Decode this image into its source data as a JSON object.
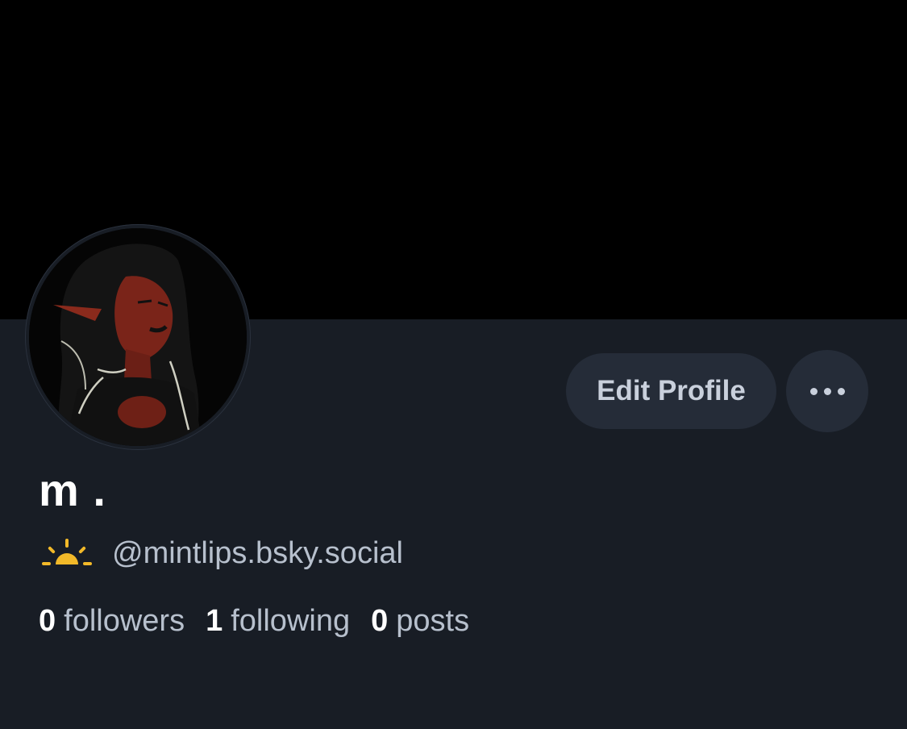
{
  "profile": {
    "display_name": "m .",
    "handle": "@mintlips.bsky.social",
    "handle_icon": "sunrise-icon",
    "banner_color": "#000000",
    "avatar_description_icon": "avatar-image"
  },
  "actions": {
    "edit_label": "Edit Profile",
    "more_icon": "ellipsis-icon"
  },
  "stats": {
    "followers": {
      "count": "0",
      "label": "followers"
    },
    "following": {
      "count": "1",
      "label": "following"
    },
    "posts": {
      "count": "0",
      "label": "posts"
    }
  },
  "colors": {
    "background": "#181d25",
    "button_bg": "#252c38",
    "muted_text": "#b7c0cd",
    "sun_yellow": "#f2b929"
  }
}
